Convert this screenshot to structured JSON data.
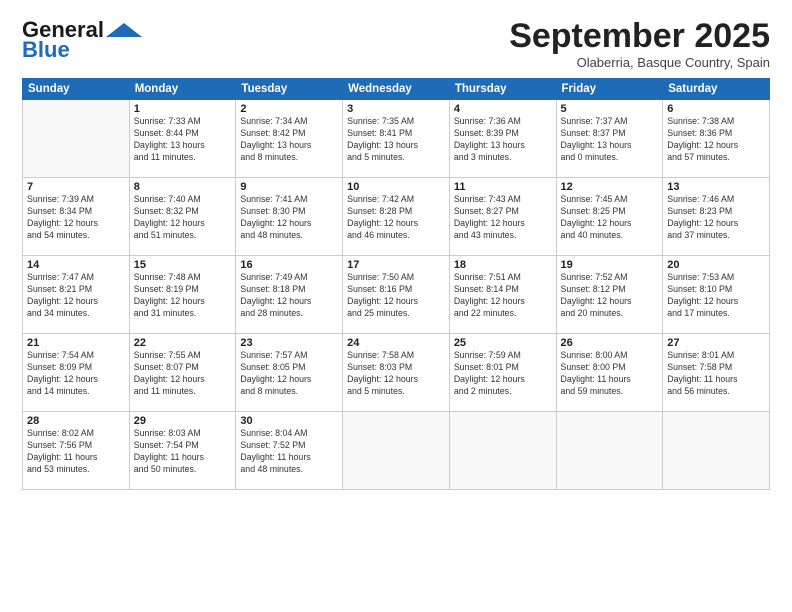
{
  "logo": {
    "line1": "General",
    "line2": "Blue"
  },
  "title": "September 2025",
  "subtitle": "Olaberria, Basque Country, Spain",
  "days_of_week": [
    "Sunday",
    "Monday",
    "Tuesday",
    "Wednesday",
    "Thursday",
    "Friday",
    "Saturday"
  ],
  "weeks": [
    [
      {
        "day": "",
        "info": ""
      },
      {
        "day": "1",
        "info": "Sunrise: 7:33 AM\nSunset: 8:44 PM\nDaylight: 13 hours\nand 11 minutes."
      },
      {
        "day": "2",
        "info": "Sunrise: 7:34 AM\nSunset: 8:42 PM\nDaylight: 13 hours\nand 8 minutes."
      },
      {
        "day": "3",
        "info": "Sunrise: 7:35 AM\nSunset: 8:41 PM\nDaylight: 13 hours\nand 5 minutes."
      },
      {
        "day": "4",
        "info": "Sunrise: 7:36 AM\nSunset: 8:39 PM\nDaylight: 13 hours\nand 3 minutes."
      },
      {
        "day": "5",
        "info": "Sunrise: 7:37 AM\nSunset: 8:37 PM\nDaylight: 13 hours\nand 0 minutes."
      },
      {
        "day": "6",
        "info": "Sunrise: 7:38 AM\nSunset: 8:36 PM\nDaylight: 12 hours\nand 57 minutes."
      }
    ],
    [
      {
        "day": "7",
        "info": "Sunrise: 7:39 AM\nSunset: 8:34 PM\nDaylight: 12 hours\nand 54 minutes."
      },
      {
        "day": "8",
        "info": "Sunrise: 7:40 AM\nSunset: 8:32 PM\nDaylight: 12 hours\nand 51 minutes."
      },
      {
        "day": "9",
        "info": "Sunrise: 7:41 AM\nSunset: 8:30 PM\nDaylight: 12 hours\nand 48 minutes."
      },
      {
        "day": "10",
        "info": "Sunrise: 7:42 AM\nSunset: 8:28 PM\nDaylight: 12 hours\nand 46 minutes."
      },
      {
        "day": "11",
        "info": "Sunrise: 7:43 AM\nSunset: 8:27 PM\nDaylight: 12 hours\nand 43 minutes."
      },
      {
        "day": "12",
        "info": "Sunrise: 7:45 AM\nSunset: 8:25 PM\nDaylight: 12 hours\nand 40 minutes."
      },
      {
        "day": "13",
        "info": "Sunrise: 7:46 AM\nSunset: 8:23 PM\nDaylight: 12 hours\nand 37 minutes."
      }
    ],
    [
      {
        "day": "14",
        "info": "Sunrise: 7:47 AM\nSunset: 8:21 PM\nDaylight: 12 hours\nand 34 minutes."
      },
      {
        "day": "15",
        "info": "Sunrise: 7:48 AM\nSunset: 8:19 PM\nDaylight: 12 hours\nand 31 minutes."
      },
      {
        "day": "16",
        "info": "Sunrise: 7:49 AM\nSunset: 8:18 PM\nDaylight: 12 hours\nand 28 minutes."
      },
      {
        "day": "17",
        "info": "Sunrise: 7:50 AM\nSunset: 8:16 PM\nDaylight: 12 hours\nand 25 minutes."
      },
      {
        "day": "18",
        "info": "Sunrise: 7:51 AM\nSunset: 8:14 PM\nDaylight: 12 hours\nand 22 minutes."
      },
      {
        "day": "19",
        "info": "Sunrise: 7:52 AM\nSunset: 8:12 PM\nDaylight: 12 hours\nand 20 minutes."
      },
      {
        "day": "20",
        "info": "Sunrise: 7:53 AM\nSunset: 8:10 PM\nDaylight: 12 hours\nand 17 minutes."
      }
    ],
    [
      {
        "day": "21",
        "info": "Sunrise: 7:54 AM\nSunset: 8:09 PM\nDaylight: 12 hours\nand 14 minutes."
      },
      {
        "day": "22",
        "info": "Sunrise: 7:55 AM\nSunset: 8:07 PM\nDaylight: 12 hours\nand 11 minutes."
      },
      {
        "day": "23",
        "info": "Sunrise: 7:57 AM\nSunset: 8:05 PM\nDaylight: 12 hours\nand 8 minutes."
      },
      {
        "day": "24",
        "info": "Sunrise: 7:58 AM\nSunset: 8:03 PM\nDaylight: 12 hours\nand 5 minutes."
      },
      {
        "day": "25",
        "info": "Sunrise: 7:59 AM\nSunset: 8:01 PM\nDaylight: 12 hours\nand 2 minutes."
      },
      {
        "day": "26",
        "info": "Sunrise: 8:00 AM\nSunset: 8:00 PM\nDaylight: 11 hours\nand 59 minutes."
      },
      {
        "day": "27",
        "info": "Sunrise: 8:01 AM\nSunset: 7:58 PM\nDaylight: 11 hours\nand 56 minutes."
      }
    ],
    [
      {
        "day": "28",
        "info": "Sunrise: 8:02 AM\nSunset: 7:56 PM\nDaylight: 11 hours\nand 53 minutes."
      },
      {
        "day": "29",
        "info": "Sunrise: 8:03 AM\nSunset: 7:54 PM\nDaylight: 11 hours\nand 50 minutes."
      },
      {
        "day": "30",
        "info": "Sunrise: 8:04 AM\nSunset: 7:52 PM\nDaylight: 11 hours\nand 48 minutes."
      },
      {
        "day": "",
        "info": ""
      },
      {
        "day": "",
        "info": ""
      },
      {
        "day": "",
        "info": ""
      },
      {
        "day": "",
        "info": ""
      }
    ]
  ]
}
